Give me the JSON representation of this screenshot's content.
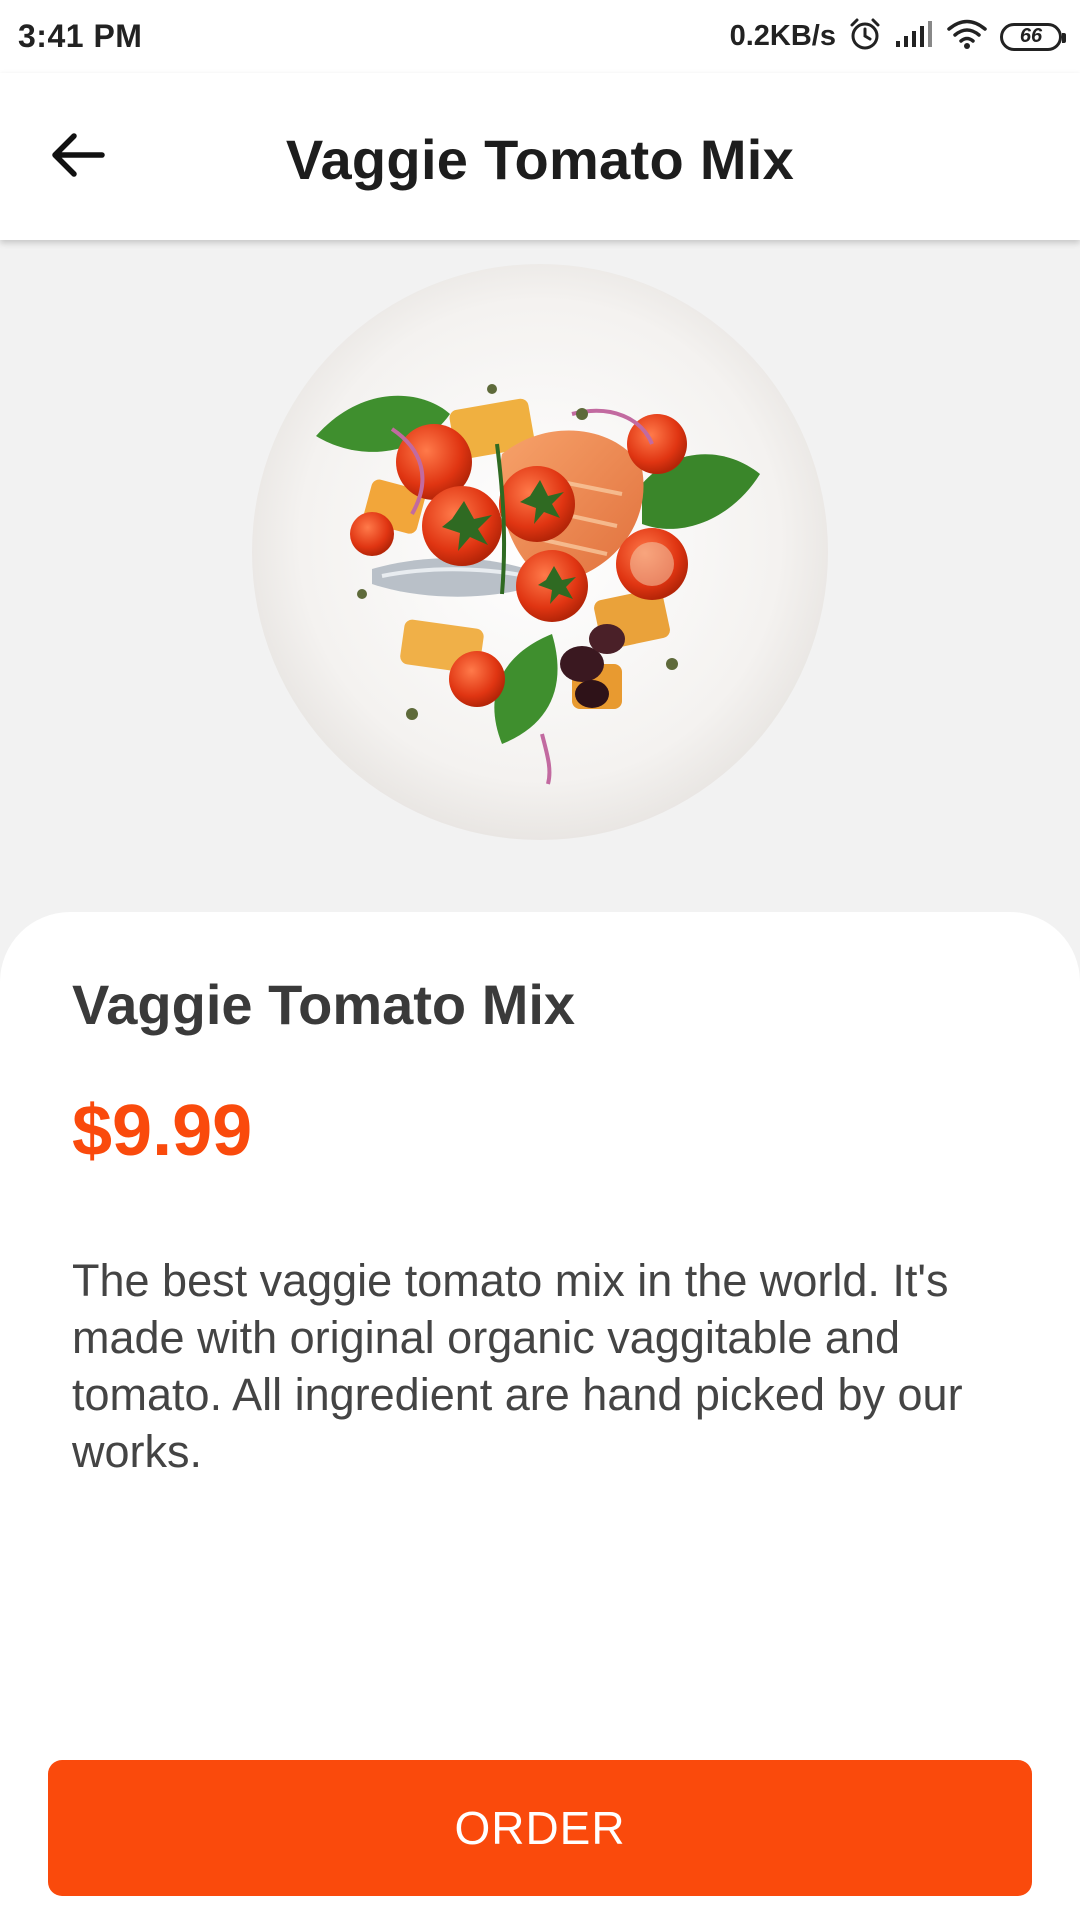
{
  "status_bar": {
    "time": "3:41 PM",
    "network_speed": "0.2KB/s",
    "battery_level": "66",
    "icons": [
      "alarm-icon",
      "signal-icon",
      "wifi-icon",
      "battery-icon"
    ]
  },
  "app_bar": {
    "title": "Vaggie Tomato Mix",
    "back_icon": "arrow-left-icon"
  },
  "hero": {
    "image": "dish-photo"
  },
  "product": {
    "name": "Vaggie Tomato Mix",
    "price": "$9.99",
    "description": "The best vaggie tomato mix in the world. It's made with original organic vaggitable and tomato. All ingredient are hand picked by our works."
  },
  "actions": {
    "order_label": "ORDER"
  },
  "colors": {
    "accent": "#FA4A0C",
    "background": "#F2F2F2",
    "card": "#FFFFFF",
    "text_dark": "#1D1D1D"
  }
}
